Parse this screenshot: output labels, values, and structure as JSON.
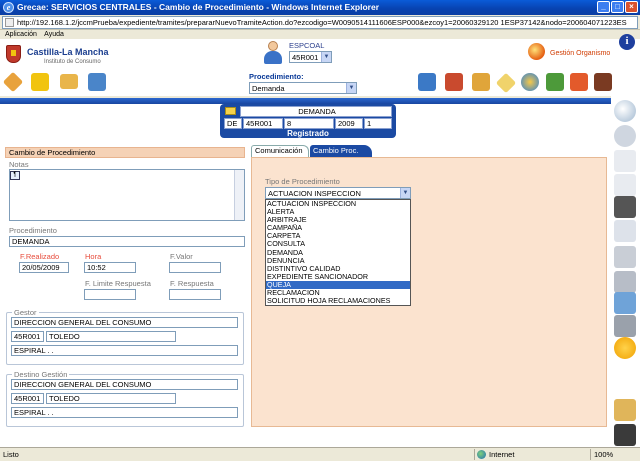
{
  "window": {
    "title": "Grecae: SERVICIOS CENTRALES - Cambio de Procedimiento - Windows Internet Explorer",
    "url": "http://192.168.1.2/jccmPrueba/expediente/tramites/prepararNuevoTramiteAction.do?ezcodigo=W0090514111606ESP000&ezcoy1=20060329120 1ESP37142&nodo=200604071223ESP68852"
  },
  "menu": [
    "Aplicación",
    "Ayuda"
  ],
  "header": {
    "logo_name": "Castilla-La Mancha",
    "logo_sub": "Instituto de Consumo",
    "espcoal_label": "ESPCOAL",
    "espcoal_value": "45R001",
    "gestion_label": "Gestión Organismo",
    "info_label": "i"
  },
  "procedimiento": {
    "label": "Procedimiento:",
    "value": "Demanda"
  },
  "demanda": {
    "title": "DEMANDA",
    "fields": [
      "DE",
      "45R001",
      "8",
      "2009",
      "1"
    ],
    "status": "Registrado"
  },
  "left": {
    "section_title": "Cambio de Procedimiento",
    "notas_label": "Notas",
    "procedimiento_label": "Procedimiento",
    "procedimiento_value": "DEMANDA",
    "f_realizado_label": "F.Realizado",
    "f_realizado_value": "20/05/2009",
    "hora_label": "Hora",
    "hora_value": "10:52",
    "f_valor_label": "F.Valor",
    "f_limite_label": "F. Limite Respuesta",
    "f_respuesta_label": "F. Respuesta",
    "gestor": {
      "label": "Gestor",
      "organismo": "DIRECCION GENERAL DEL CONSUMO",
      "codigo": "45R001",
      "ciudad": "TOLEDO",
      "persona": "ESPIRAL . ."
    },
    "destino": {
      "label": "Destino Gestión",
      "organismo": "DIRECCION GENERAL DEL CONSUMO",
      "codigo": "45R001",
      "ciudad": "TOLEDO",
      "persona": "ESPIRAL . ."
    }
  },
  "right": {
    "tabs": [
      "Comunicación",
      "Cambio Proc."
    ],
    "tipo_label": "Tipo de Procedimiento",
    "tipo_value": "ACTUACION INSPECCION",
    "tipo_options": [
      "ACTUACION INSPECCION",
      "ALERTA",
      "ARBITRAJE",
      "CAMPAÑA",
      "CARPETA",
      "CONSULTA",
      "DEMANDA",
      "DENUNCIA",
      "DISTINTIVO CALIDAD",
      "EXPEDIENTE SANCIONADOR",
      "QUEJA",
      "RECLAMACION",
      "SOLICITUD HOJA RECLAMACIONES"
    ],
    "tipo_selected_index": 10
  },
  "status": {
    "left": "Listo",
    "zone": "Internet",
    "zoom": "100%"
  }
}
